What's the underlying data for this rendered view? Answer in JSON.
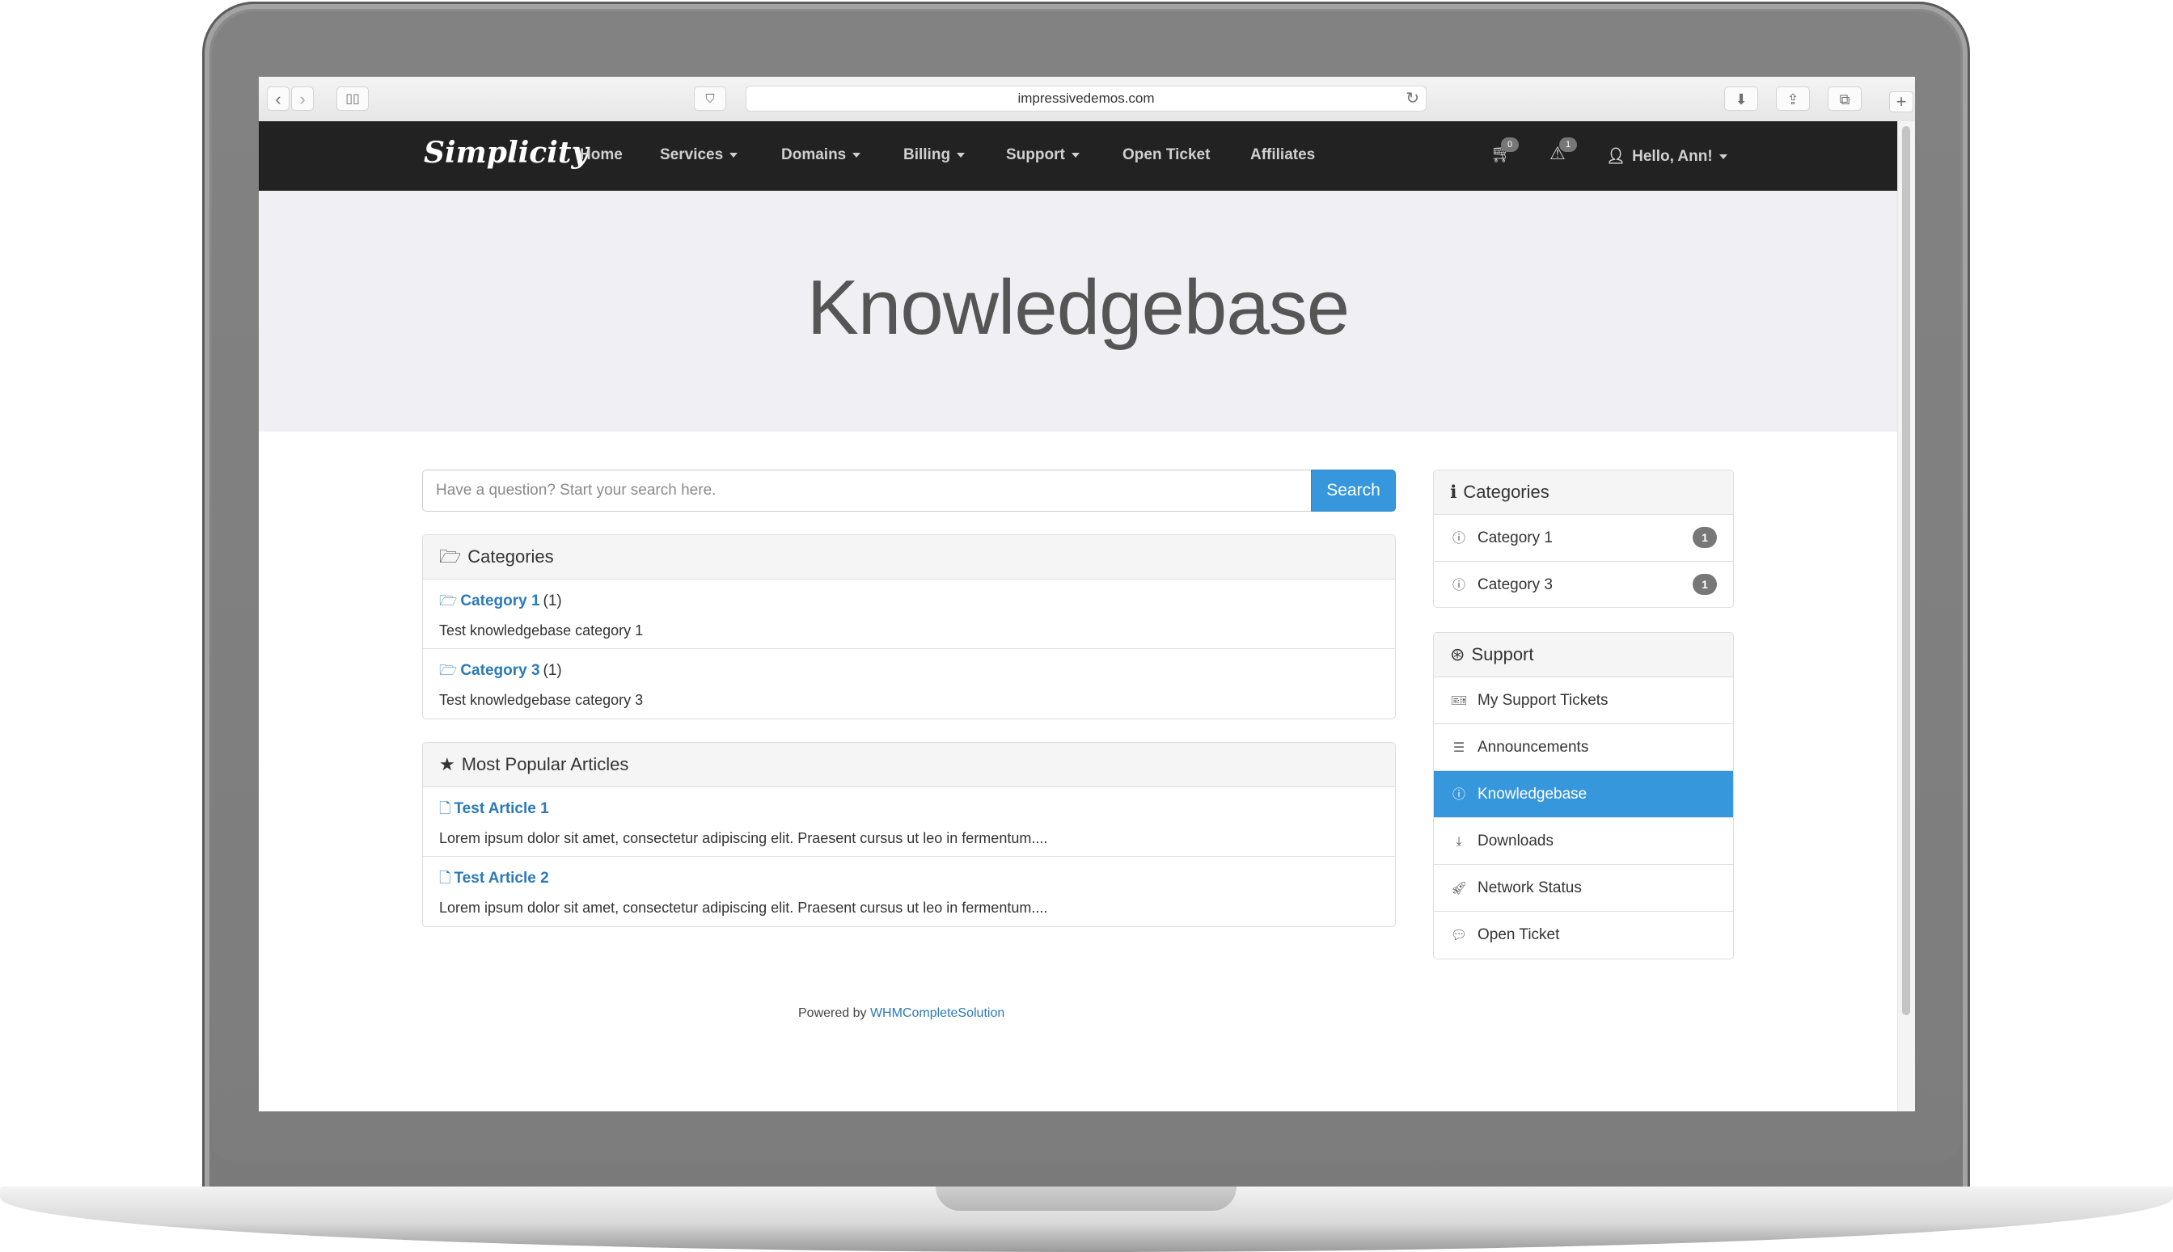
{
  "browser": {
    "url": "impressivedemos.com",
    "icons": [
      "back-icon",
      "forward-icon",
      "sidebar-icon",
      "pocket-icon",
      "reload-icon",
      "download-icon",
      "share-icon",
      "tabs-icon",
      "new-tab-icon"
    ]
  },
  "navbar": {
    "brand": "Simplicity",
    "items": [
      {
        "label": "Home",
        "dropdown": false
      },
      {
        "label": "Services",
        "dropdown": true
      },
      {
        "label": "Domains",
        "dropdown": true
      },
      {
        "label": "Billing",
        "dropdown": true
      },
      {
        "label": "Support",
        "dropdown": true
      },
      {
        "label": "Open Ticket",
        "dropdown": false
      },
      {
        "label": "Affiliates",
        "dropdown": false
      }
    ],
    "cart_count": "0",
    "alert_count": "1",
    "user_label": "Hello, Ann!"
  },
  "hero": {
    "title": "Knowledgebase"
  },
  "search": {
    "placeholder": "Have a question? Start your search here.",
    "button_label": "Search"
  },
  "categories_panel": {
    "title": "Categories",
    "items": [
      {
        "name": "Category 1",
        "count": "(1)",
        "description": "Test knowledgebase category 1"
      },
      {
        "name": "Category 3",
        "count": "(1)",
        "description": "Test knowledgebase category 3"
      }
    ]
  },
  "popular_panel": {
    "title": "Most Popular Articles",
    "items": [
      {
        "name": "Test Article 1",
        "description": "Lorem ipsum dolor sit amet, consectetur adipiscing elit. Praesent cursus ut leo in fermentum...."
      },
      {
        "name": "Test Article 2",
        "description": "Lorem ipsum dolor sit amet, consectetur adipiscing elit. Praesent cursus ut leo in fermentum...."
      }
    ]
  },
  "sidebar_categories": {
    "title": "Categories",
    "items": [
      {
        "label": "Category 1",
        "badge": "1"
      },
      {
        "label": "Category 3",
        "badge": "1"
      }
    ]
  },
  "sidebar_support": {
    "title": "Support",
    "items": [
      {
        "label": "My Support Tickets",
        "icon": "ticket-icon"
      },
      {
        "label": "Announcements",
        "icon": "list-icon"
      },
      {
        "label": "Knowledgebase",
        "icon": "info-icon",
        "active": true
      },
      {
        "label": "Downloads",
        "icon": "download-icon"
      },
      {
        "label": "Network Status",
        "icon": "rocket-icon"
      },
      {
        "label": "Open Ticket",
        "icon": "comments-icon"
      }
    ]
  },
  "footer": {
    "prefix": "Powered by",
    "link": "WHMCompleteSolution"
  },
  "colors": {
    "accent": "#3797dc",
    "link": "#2a7ab8",
    "navbar_bg": "#222222",
    "hero_bg": "#f0f0f4"
  }
}
